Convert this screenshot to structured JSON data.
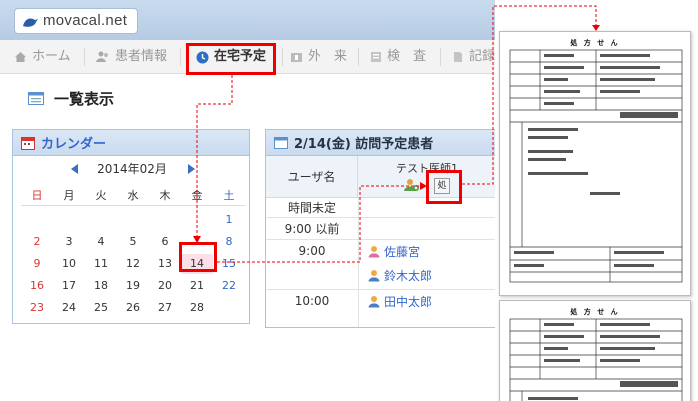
{
  "logo": {
    "text": "movacal.net"
  },
  "nav": {
    "items": [
      {
        "label": "ホーム",
        "icon": "home-icon"
      },
      {
        "label": "患者情報",
        "icon": "patients-icon"
      },
      {
        "label": "在宅予定",
        "icon": "clock-icon"
      },
      {
        "label": "外　来",
        "icon": "clinic-icon"
      },
      {
        "label": "検　査",
        "icon": "test-icon"
      },
      {
        "label": "記録",
        "icon": "record-icon"
      }
    ],
    "active": "在宅予定"
  },
  "page_title": "一覧表示",
  "calendar": {
    "title": "カレンダー",
    "month": "2014年02月",
    "weekdays": [
      "日",
      "月",
      "火",
      "水",
      "木",
      "金",
      "土"
    ],
    "weeks": [
      [
        "",
        "",
        "",
        "",
        "",
        "",
        "1"
      ],
      [
        "2",
        "3",
        "4",
        "5",
        "6",
        "7",
        "8"
      ],
      [
        "9",
        "10",
        "11",
        "12",
        "13",
        "14",
        "15"
      ],
      [
        "16",
        "17",
        "18",
        "19",
        "20",
        "21",
        "22"
      ],
      [
        "23",
        "24",
        "25",
        "26",
        "27",
        "28",
        ""
      ]
    ],
    "selected": "14"
  },
  "schedule": {
    "title": "2/14(金) 訪問予定患者",
    "col_user": "ユーザ名",
    "col_doctor": "テスト医師1",
    "print_button": "処",
    "rows": [
      {
        "time": "時間未定",
        "patients": []
      },
      {
        "time": "9:00 以前",
        "patients": []
      },
      {
        "time": "9:00",
        "patients": [
          "佐藤宮",
          "鈴木太郎"
        ]
      },
      {
        "time": "10:00",
        "patients": [
          "田中太郎"
        ]
      }
    ]
  },
  "prescription": {
    "title": "処 方 せ ん"
  },
  "colors": {
    "accent": "#3366cc",
    "highlight_red": "#ee0000",
    "selected_day_bg": "#fbe0ea",
    "header_bg": "#c9dbee"
  }
}
